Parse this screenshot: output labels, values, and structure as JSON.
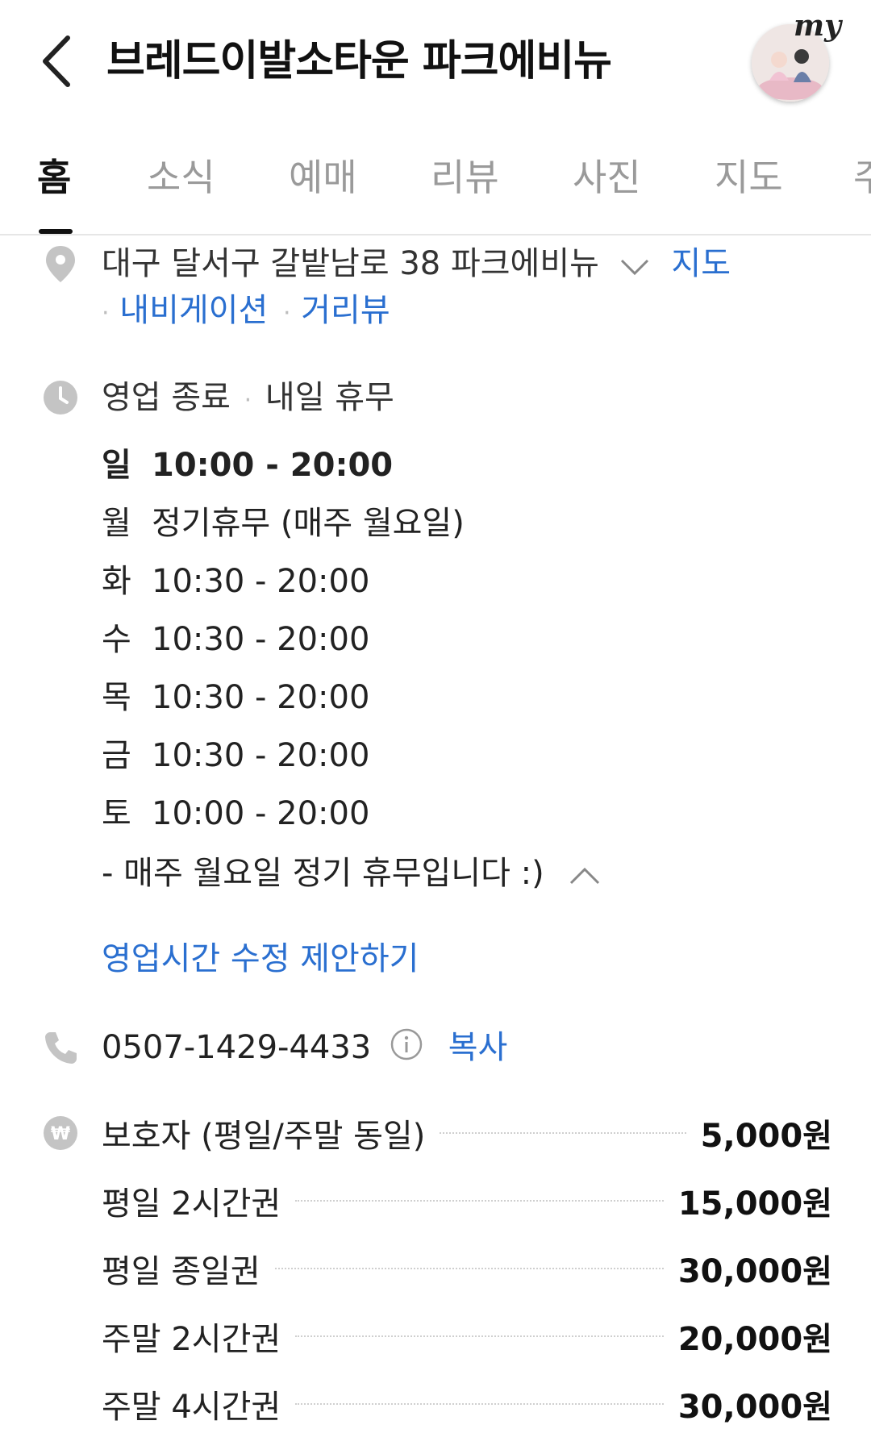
{
  "header": {
    "title": "브레드이발소타운 파크에비뉴",
    "my_label": "my"
  },
  "tabs": [
    {
      "label": "홈",
      "active": true
    },
    {
      "label": "소식"
    },
    {
      "label": "예매"
    },
    {
      "label": "리뷰"
    },
    {
      "label": "사진"
    },
    {
      "label": "지도"
    },
    {
      "label": "주"
    }
  ],
  "address": {
    "text": "대구 달서구 갈밭남로 38 파크에비뉴",
    "map_link": "지도",
    "navigation_link": "내비게이션",
    "streetview_link": "거리뷰"
  },
  "status": {
    "state": "영업 종료",
    "next": "내일 휴무"
  },
  "hours": [
    {
      "day": "일",
      "time": "10:00 - 20:00",
      "today": true
    },
    {
      "day": "월",
      "time": "정기휴무 (매주 월요일)"
    },
    {
      "day": "화",
      "time": "10:30 - 20:00"
    },
    {
      "day": "수",
      "time": "10:30 - 20:00"
    },
    {
      "day": "목",
      "time": "10:30 - 20:00"
    },
    {
      "day": "금",
      "time": "10:30 - 20:00"
    },
    {
      "day": "토",
      "time": "10:00 - 20:00"
    }
  ],
  "hours_note": "- 매주 월요일 정기 휴무입니다 :)",
  "suggest_edit": "영업시간 수정 제안하기",
  "phone": {
    "number": "0507-1429-4433",
    "copy_label": "복사"
  },
  "prices": [
    {
      "label": "보호자 (평일/주말 동일)",
      "value": "5,000원"
    },
    {
      "label": "평일 2시간권",
      "value": "15,000원"
    },
    {
      "label": "평일 종일권",
      "value": "30,000원"
    },
    {
      "label": "주말 2시간권",
      "value": "20,000원"
    },
    {
      "label": "주말 4시간권",
      "value": "30,000원"
    }
  ],
  "colors": {
    "link": "#2a6fd0",
    "icon_gray": "#c4c4c4"
  }
}
